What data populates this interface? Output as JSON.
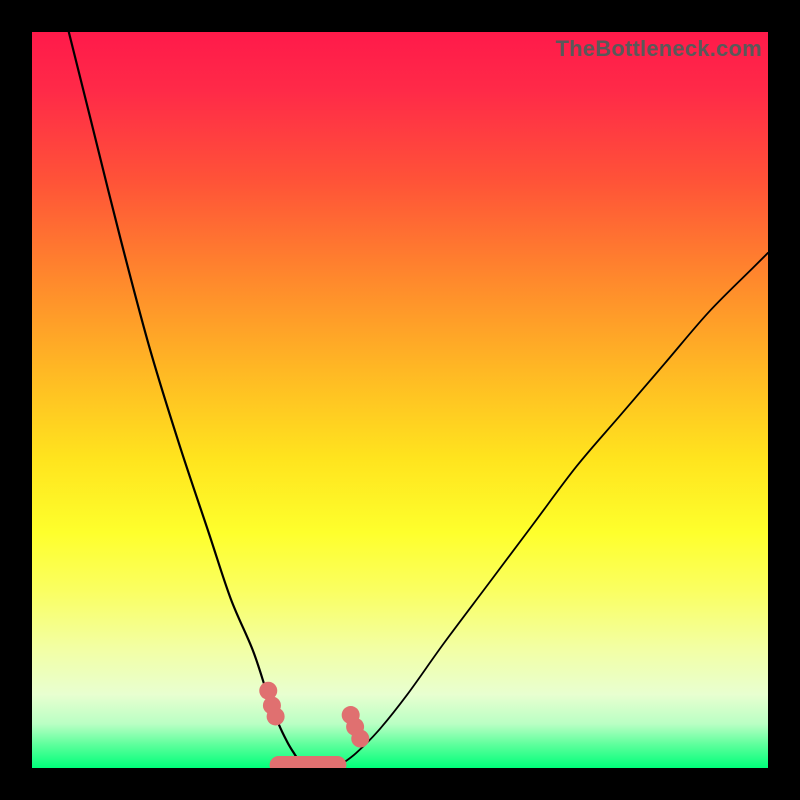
{
  "watermark": "TheBottleneck.com",
  "chart_data": {
    "type": "line",
    "title": "",
    "xlabel": "",
    "ylabel": "",
    "xlim": [
      0,
      100
    ],
    "ylim": [
      0,
      100
    ],
    "grid": false,
    "legend": false,
    "series": [
      {
        "name": "left-curve",
        "x": [
          5,
          8,
          12,
          16,
          20,
          24,
          27,
          30,
          32,
          33.5,
          34.7,
          35.6,
          36.3,
          37
        ],
        "y": [
          100,
          88,
          72,
          57,
          44,
          32,
          23,
          16,
          10,
          6,
          3.5,
          2,
          1,
          0.5
        ]
      },
      {
        "name": "right-curve",
        "x": [
          42,
          44,
          47,
          51,
          56,
          62,
          68,
          74,
          80,
          86,
          92,
          98,
          100
        ],
        "y": [
          0.5,
          2,
          5,
          10,
          17,
          25,
          33,
          41,
          48,
          55,
          62,
          68,
          70
        ]
      },
      {
        "name": "bottom-band",
        "x": [
          33.5,
          41.5
        ],
        "y": [
          0.4,
          0.4
        ]
      }
    ],
    "markers": [
      {
        "x": 32.1,
        "y": 10.5
      },
      {
        "x": 32.6,
        "y": 8.5
      },
      {
        "x": 33.1,
        "y": 7.0
      },
      {
        "x": 43.3,
        "y": 7.2
      },
      {
        "x": 43.9,
        "y": 5.6
      },
      {
        "x": 44.6,
        "y": 4.0
      }
    ],
    "gradient_stops": [
      {
        "pos": 0,
        "color": "#ff1a4a"
      },
      {
        "pos": 50,
        "color": "#ffe41e"
      },
      {
        "pos": 100,
        "color": "#00ff7a"
      }
    ]
  }
}
